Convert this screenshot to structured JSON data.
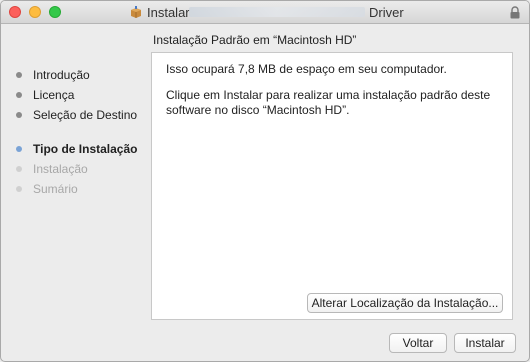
{
  "window": {
    "title_prefix": "Instalar",
    "title_suffix": "Driver"
  },
  "subtitle": "Instalação Padrão em “Macintosh HD”",
  "steps": [
    {
      "label": "Introdução",
      "state": "done"
    },
    {
      "label": "Licença",
      "state": "done"
    },
    {
      "label": "Seleção de Destino",
      "state": "done"
    },
    {
      "label": "Tipo de Instalação",
      "state": "current"
    },
    {
      "label": "Instalação",
      "state": "future"
    },
    {
      "label": "Sumário",
      "state": "future"
    }
  ],
  "panel": {
    "space_text": "Isso ocupará 7,8 MB de espaço em seu computador.",
    "install_text": "Clique em Instalar para realizar uma instalação padrão deste software no disco “Macintosh HD”."
  },
  "buttons": {
    "change_location": "Alterar Localização da Instalação...",
    "back": "Voltar",
    "install": "Instalar"
  }
}
